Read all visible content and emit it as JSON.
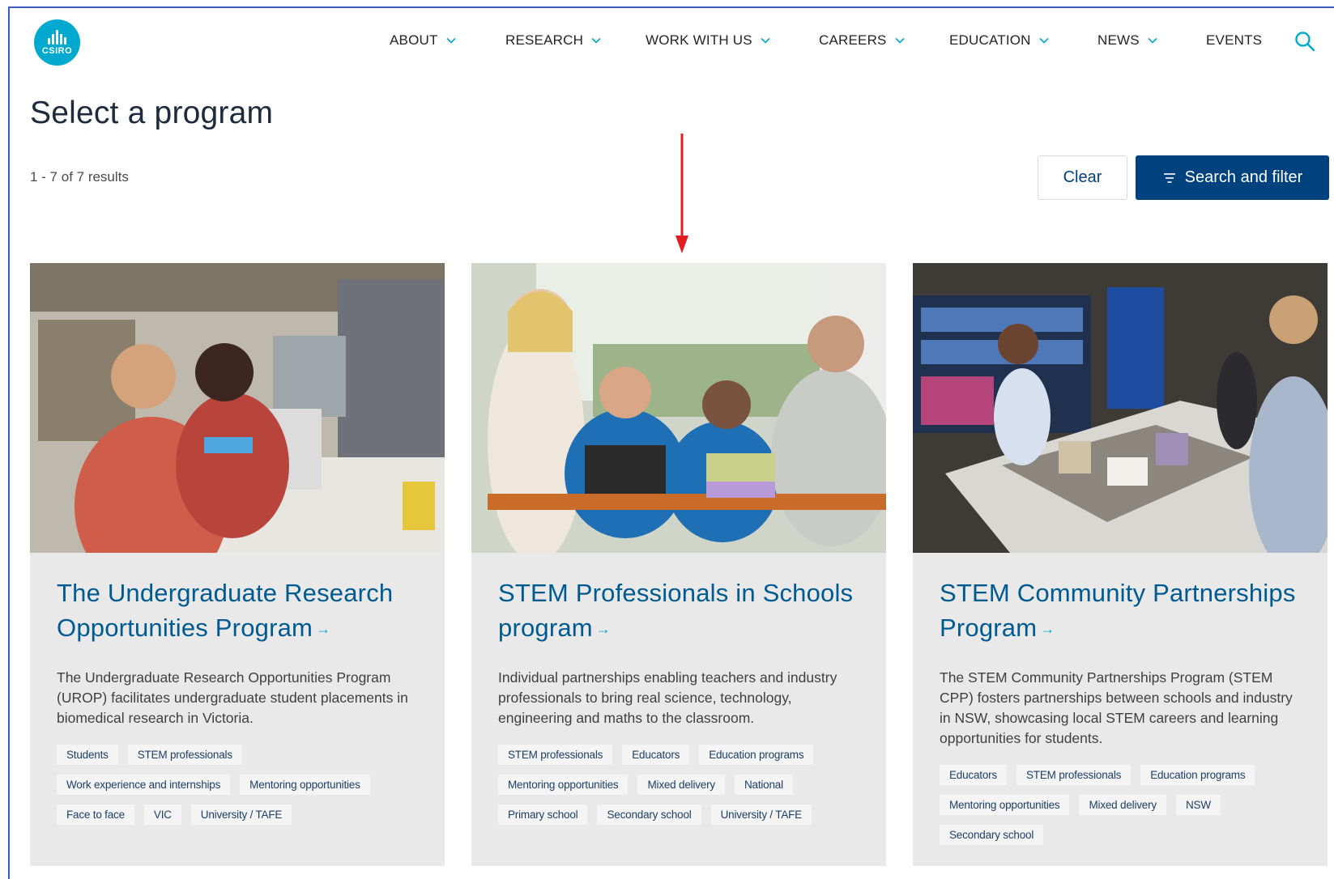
{
  "logo": {
    "text": "CSIRO",
    "icon": "csiro-logo-icon"
  },
  "nav": [
    {
      "label": "ABOUT",
      "dropdown": true
    },
    {
      "label": "RESEARCH",
      "dropdown": true
    },
    {
      "label": "WORK WITH US",
      "dropdown": true
    },
    {
      "label": "CAREERS",
      "dropdown": true
    },
    {
      "label": "EDUCATION",
      "dropdown": true
    },
    {
      "label": "NEWS",
      "dropdown": true
    },
    {
      "label": "EVENTS",
      "dropdown": false
    }
  ],
  "page": {
    "title": "Select a program",
    "results": "1 - 7 of 7 results",
    "clear_label": "Clear",
    "filter_label": "Search and filter"
  },
  "colors": {
    "brand": "#00a9ce",
    "primary_button": "#00427e",
    "card_title": "#005a92",
    "annotation_arrow": "#e31b23"
  },
  "cards": [
    {
      "title": "The Undergraduate Research Opportunities Program",
      "description": "The Undergraduate Research Opportunities Program (UROP) facilitates undergraduate student placements in biomedical research in Victoria.",
      "tags": [
        "Students",
        "STEM professionals",
        "Work experience and internships",
        "Mentoring opportunities",
        "Face to face",
        "VIC",
        "University / TAFE"
      ]
    },
    {
      "title": "STEM Professionals in Schools program",
      "description": "Individual partnerships enabling teachers and industry professionals to bring real science, technology, engineering and maths to the classroom.",
      "tags": [
        "STEM professionals",
        "Educators",
        "Education programs",
        "Mentoring opportunities",
        "Mixed delivery",
        "National",
        "Primary school",
        "Secondary school",
        "University / TAFE"
      ]
    },
    {
      "title": "STEM Community Partnerships Program",
      "description": "The STEM Community Partnerships Program (STEM CPP) fosters partnerships between schools and industry in NSW, showcasing local STEM careers and learning opportunities for students.",
      "tags": [
        "Educators",
        "STEM professionals",
        "Education programs",
        "Mentoring opportunities",
        "Mixed delivery",
        "NSW",
        "Secondary school"
      ]
    }
  ]
}
